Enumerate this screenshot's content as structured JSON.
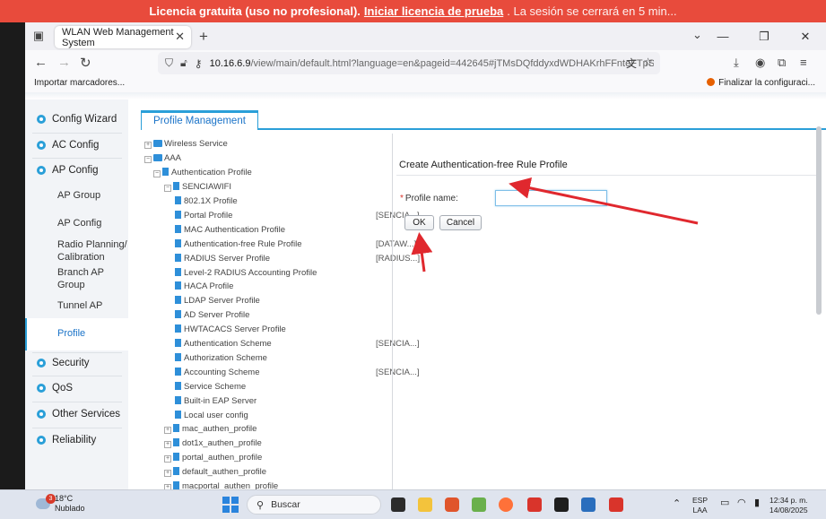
{
  "banner": {
    "prefix": "Licencia gratuita (uso no profesional).",
    "link": "Iniciar licencia de prueba",
    "suffix": ". La sesión se cerrará en 5 min..."
  },
  "browser": {
    "tab_title": "WLAN Web Management System",
    "url_host": "10.16.6.9",
    "url_rest": "/view/main/default.html?language=en&pageid=442645#jTMsDQfddyxdWDHAKrhFFnteFTpSedxp",
    "bookmark_import": "Importar marcadores...",
    "bookmark_right": "Finalizar la configuraci..."
  },
  "sidebar": {
    "config_wizard": "Config Wizard",
    "ac_config": "AC Config",
    "ap_config": "AP Config",
    "sub": {
      "ap_group": "AP Group",
      "ap_config": "AP Config",
      "radio_planning": "Radio Planning/ Calibration",
      "branch_ap_group": "Branch AP Group",
      "tunnel_ap": "Tunnel AP",
      "profile": "Profile"
    },
    "security": "Security",
    "qos": "QoS",
    "other_services": "Other Services",
    "reliability": "Reliability"
  },
  "profile_tab": "Profile Management",
  "tree": {
    "wireless_service": "Wireless Service",
    "aaa": "AAA",
    "authentication_profile": "Authentication Profile",
    "senciawifi": "SENCIAWIFI",
    "children": [
      {
        "label": "802.1X Profile",
        "tag": ""
      },
      {
        "label": "Portal Profile",
        "tag": "[SENCIA...]"
      },
      {
        "label": "MAC Authentication Profile",
        "tag": ""
      },
      {
        "label": "Authentication-free Rule Profile",
        "tag": "[DATAW...]"
      },
      {
        "label": "RADIUS Server Profile",
        "tag": "[RADIUS...]"
      },
      {
        "label": "Level-2 RADIUS Accounting Profile",
        "tag": ""
      },
      {
        "label": "HACA Profile",
        "tag": ""
      },
      {
        "label": "LDAP Server Profile",
        "tag": ""
      },
      {
        "label": "AD Server Profile",
        "tag": ""
      },
      {
        "label": "HWTACACS Server Profile",
        "tag": ""
      },
      {
        "label": "Authentication Scheme",
        "tag": "[SENCIA...]"
      },
      {
        "label": "Authorization Scheme",
        "tag": ""
      },
      {
        "label": "Accounting Scheme",
        "tag": "[SENCIA...]"
      },
      {
        "label": "Service Scheme",
        "tag": ""
      },
      {
        "label": "Built-in EAP Server",
        "tag": ""
      },
      {
        "label": "Local user config",
        "tag": ""
      }
    ],
    "siblings": [
      "mac_authen_profile",
      "dot1x_authen_profile",
      "portal_authen_profile",
      "default_authen_profile",
      "macportal_authen_profile"
    ]
  },
  "form": {
    "title": "Create Authentication-free Rule Profile",
    "profile_name_label": "Profile name:",
    "profile_name_value": "",
    "ok": "OK",
    "cancel": "Cancel"
  },
  "taskbar": {
    "temperature": "18°C",
    "weather": "Nublado",
    "weather_badge": "3",
    "search": "Buscar",
    "lang": "ESP",
    "layout": "LAA",
    "time": "12:34 p. m.",
    "date": "14/08/2025"
  },
  "colors": {
    "banner": "#e84b3c",
    "accent": "#2a9fd8",
    "arrow": "#e0282e"
  }
}
